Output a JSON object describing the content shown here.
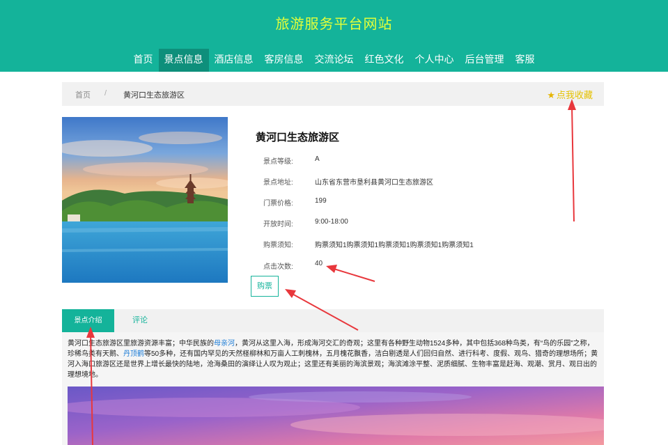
{
  "header": {
    "title": "旅游服务平台网站"
  },
  "nav": {
    "items": [
      "首页",
      "景点信息",
      "酒店信息",
      "客房信息",
      "交流论坛",
      "红色文化",
      "个人中心",
      "后台管理",
      "客服"
    ],
    "active_index": 1
  },
  "breadcrumb": {
    "home": "首页",
    "separator": "/",
    "current": "黄河口生态旅游区"
  },
  "favorite": {
    "icon": "star-icon",
    "label": "点我收藏"
  },
  "detail": {
    "title": "黄河口生态旅游区",
    "attributes": [
      {
        "label": "景点等级:",
        "value": "A"
      },
      {
        "label": "景点地址:",
        "value": "山东省东营市垦利县黄河口生态旅游区"
      },
      {
        "label": "门票价格:",
        "value": "199"
      },
      {
        "label": "开放时间:",
        "value": "9:00-18:00"
      },
      {
        "label": "购票须知:",
        "value": "购票须知1购票须知1购票须知1购票须知1购票须知1"
      },
      {
        "label": "点击次数:",
        "value": "40"
      }
    ],
    "buy_label": "购票"
  },
  "tabs": {
    "intro": "景点介绍",
    "comment": "评论"
  },
  "intro": {
    "p1": "黄河口生态旅游区里旅游资源丰富；中华民族的",
    "link1": "母亲河",
    "p2": "，黄河从这里入海，形成海河交汇的奇观；这里有各种野生动物1524多种，其中包括368种鸟类，有“鸟的乐园”之称，珍稀鸟类有天鹅、",
    "link2": "丹顶鹤",
    "p3": "等50多种，还有国内罕见的天然柽柳林和万亩人工刺槐林，五月槐花飘香，洁白剔透是人们回归自然、进行科考、度假、观鸟、猎奇的理想场所；黄河入海口旅游区还是世界上增长最快的陆地，沧海桑田的演绎让人叹为观止；这里还有美丽的海滨景观；海滨滩涂平整、泥质细腻、生物丰富是赶海、观潮、赏月、观日出的理想境地。"
  },
  "colors": {
    "header_bg": "#14b39a",
    "title_color": "#e2ff3a",
    "nav_active": "#0e8f7b",
    "favorite": "#e5c100",
    "link": "#1a7bd6",
    "annotation_arrow": "#e8373c"
  }
}
